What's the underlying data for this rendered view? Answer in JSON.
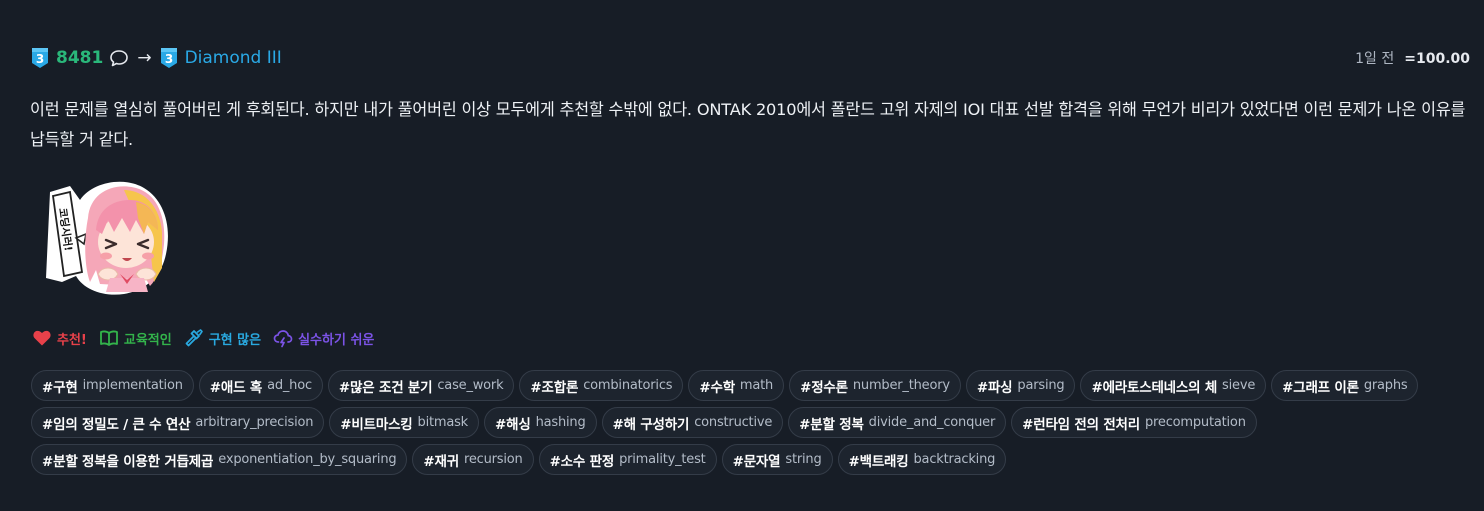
{
  "header": {
    "old_tier_num": "3",
    "old_rating": "8481",
    "arrow": "→",
    "new_tier_num": "3",
    "new_tier": "Diamond III",
    "time": "1일 전",
    "score": "=100.00",
    "colors": {
      "rating_green": "#2ab77a",
      "diamond_blue": "#2aa9e6"
    }
  },
  "body_text": "이런 문제를 열심히 풀어버린 게 후회된다. 하지만 내가 풀어버린 이상 모두에게 추천할 수밖에 없다. ONTAK 2010에서 폴란드 고위 자제의 IOI 대표 선발 합격을 위해 무언가 비리가 있었다면 이런 문제가 나온 이유를 납득할 거 같다.",
  "sticker": {
    "speech": "코딩시러!",
    "icon": "anime-girl-sticker"
  },
  "opinions": [
    {
      "label": "추천!",
      "icon": "heart-icon",
      "color": "#e8414a"
    },
    {
      "label": "교육적인",
      "icon": "book-icon",
      "color": "#33b34b"
    },
    {
      "label": "구현 많은",
      "icon": "hammer-icon",
      "color": "#29a9e0"
    },
    {
      "label": "실수하기 쉬운",
      "icon": "cloud-lightning-icon",
      "color": "#7b53e6"
    }
  ],
  "tags": [
    {
      "ko": "#구현",
      "en": "implementation"
    },
    {
      "ko": "#애드 혹",
      "en": "ad_hoc"
    },
    {
      "ko": "#많은 조건 분기",
      "en": "case_work"
    },
    {
      "ko": "#조합론",
      "en": "combinatorics"
    },
    {
      "ko": "#수학",
      "en": "math"
    },
    {
      "ko": "#정수론",
      "en": "number_theory"
    },
    {
      "ko": "#파싱",
      "en": "parsing"
    },
    {
      "ko": "#에라토스테네스의 체",
      "en": "sieve"
    },
    {
      "ko": "#그래프 이론",
      "en": "graphs"
    },
    {
      "ko": "#임의 정밀도 / 큰 수 연산",
      "en": "arbitrary_precision"
    },
    {
      "ko": "#비트마스킹",
      "en": "bitmask"
    },
    {
      "ko": "#해싱",
      "en": "hashing"
    },
    {
      "ko": "#해 구성하기",
      "en": "constructive"
    },
    {
      "ko": "#분할 정복",
      "en": "divide_and_conquer"
    },
    {
      "ko": "#런타임 전의 전처리",
      "en": "precomputation"
    },
    {
      "ko": "#분할 정복을 이용한 거듭제곱",
      "en": "exponentiation_by_squaring"
    },
    {
      "ko": "#재귀",
      "en": "recursion"
    },
    {
      "ko": "#소수 판정",
      "en": "primality_test"
    },
    {
      "ko": "#문자열",
      "en": "string"
    },
    {
      "ko": "#백트래킹",
      "en": "backtracking"
    }
  ]
}
